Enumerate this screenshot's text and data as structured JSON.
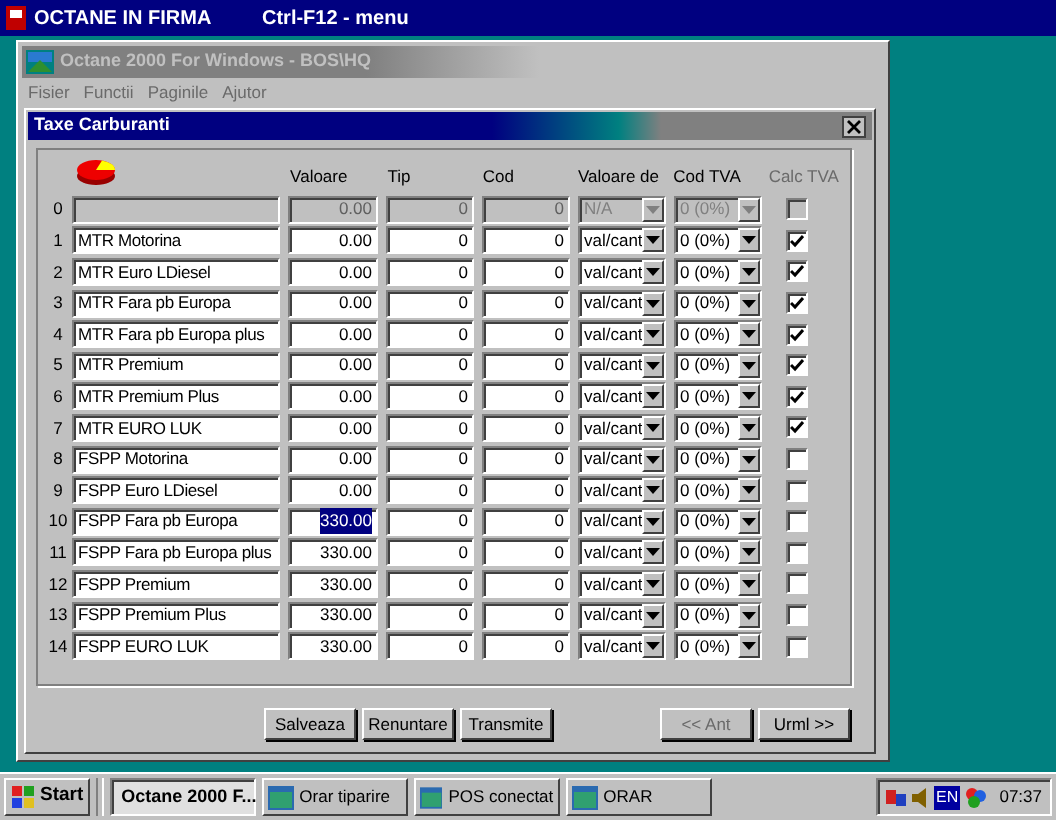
{
  "app_bar": {
    "title": "OCTANE IN FIRMA",
    "shortcut": "Ctrl-F12 - menu"
  },
  "main_window": {
    "title": "Octane 2000 For Windows - BOS\\HQ",
    "active": false,
    "menu": [
      "Fisier",
      "Functii",
      "Paginile",
      "Ajutor"
    ]
  },
  "dialog": {
    "title": "Taxe Carburanti",
    "columns": [
      {
        "label": "Valoare",
        "disabled": false
      },
      {
        "label": "Tip",
        "disabled": false
      },
      {
        "label": "Cod",
        "disabled": false
      },
      {
        "label": "Valoare de",
        "disabled": false
      },
      {
        "label": "Cod TVA",
        "disabled": false
      },
      {
        "label": "Calc TVA",
        "disabled": true
      }
    ],
    "rows": [
      {
        "number": "0",
        "value": "0.00",
        "type": "0",
        "code": "0",
        "value_of": "N/A",
        "vat_code": "0 (0%)",
        "calc_vat": false,
        "disabled": true,
        "value_highlighted": false
      },
      {
        "number": "1",
        "name": "MTR Motorina",
        "value": "0.00",
        "type": "0",
        "code": "0",
        "value_of": "val/cant",
        "vat_code": "0 (0%)",
        "calc_vat": true,
        "disabled": false,
        "value_highlighted": false
      },
      {
        "number": "2",
        "name": "MTR Euro LDiesel",
        "value": "0.00",
        "type": "0",
        "code": "0",
        "value_of": "val/cant",
        "vat_code": "0 (0%)",
        "calc_vat": true,
        "disabled": false,
        "value_highlighted": false
      },
      {
        "number": "3",
        "name": "MTR Fara pb Europa",
        "value": "0.00",
        "type": "0",
        "code": "0",
        "value_of": "val/cant",
        "vat_code": "0 (0%)",
        "calc_vat": true,
        "disabled": false,
        "value_highlighted": false
      },
      {
        "number": "4",
        "name": "MTR Fara pb Europa plus",
        "value": "0.00",
        "type": "0",
        "code": "0",
        "value_of": "val/cant",
        "vat_code": "0 (0%)",
        "calc_vat": true,
        "disabled": false,
        "value_highlighted": false
      },
      {
        "number": "5",
        "name": "MTR Premium",
        "value": "0.00",
        "type": "0",
        "code": "0",
        "value_of": "val/cant",
        "vat_code": "0 (0%)",
        "calc_vat": true,
        "disabled": false,
        "value_highlighted": false
      },
      {
        "number": "6",
        "name": "MTR Premium Plus",
        "value": "0.00",
        "type": "0",
        "code": "0",
        "value_of": "val/cant",
        "vat_code": "0 (0%)",
        "calc_vat": true,
        "disabled": false,
        "value_highlighted": false
      },
      {
        "number": "7",
        "name": "MTR EURO LUK",
        "value": "0.00",
        "type": "0",
        "code": "0",
        "value_of": "val/cant",
        "vat_code": "0 (0%)",
        "calc_vat": true,
        "disabled": false,
        "value_highlighted": false
      },
      {
        "number": "8",
        "name": "FSPP Motorina",
        "value": "0.00",
        "type": "0",
        "code": "0",
        "value_of": "val/cant",
        "vat_code": "0 (0%)",
        "calc_vat": false,
        "disabled": false,
        "value_highlighted": false
      },
      {
        "number": "9",
        "name": "FSPP Euro LDiesel",
        "value": "0.00",
        "type": "0",
        "code": "0",
        "value_of": "val/cant",
        "vat_code": "0 (0%)",
        "calc_vat": false,
        "disabled": false,
        "value_highlighted": false
      },
      {
        "number": "10",
        "name": "FSPP Fara pb Europa",
        "value": "330.00",
        "type": "0",
        "code": "0",
        "value_of": "val/cant",
        "vat_code": "0 (0%)",
        "calc_vat": false,
        "disabled": false,
        "value_highlighted": true
      },
      {
        "number": "11",
        "name": "FSPP Fara pb Europa plus",
        "value": "330.00",
        "type": "0",
        "code": "0",
        "value_of": "val/cant",
        "vat_code": "0 (0%)",
        "calc_vat": false,
        "disabled": false,
        "value_highlighted": false
      },
      {
        "number": "12",
        "name": "FSPP Premium",
        "value": "330.00",
        "type": "0",
        "code": "0",
        "value_of": "val/cant",
        "vat_code": "0 (0%)",
        "calc_vat": false,
        "disabled": false,
        "value_highlighted": false
      },
      {
        "number": "13",
        "name": "FSPP Premium Plus",
        "value": "330.00",
        "type": "0",
        "code": "0",
        "value_of": "val/cant",
        "vat_code": "0 (0%)",
        "calc_vat": false,
        "disabled": false,
        "value_highlighted": false
      },
      {
        "number": "14",
        "name": "FSPP EURO LUK",
        "value": "330.00",
        "type": "0",
        "code": "0",
        "value_of": "val/cant",
        "vat_code": "0 (0%)",
        "calc_vat": false,
        "disabled": false,
        "value_highlighted": false
      }
    ],
    "buttons": [
      {
        "label": "Salveaza",
        "disabled": false
      },
      {
        "label": "Renuntare",
        "disabled": false
      },
      {
        "label": "Transmite",
        "disabled": false
      },
      {
        "label": "<< Ant",
        "disabled": true
      },
      {
        "label": "Urml >>",
        "disabled": false
      }
    ]
  },
  "taskbar": {
    "start": "Start",
    "tasks": [
      {
        "label": "Octane 2000 F...",
        "selected": true
      },
      {
        "label": "Orar tiparire",
        "selected": false
      },
      {
        "label": "POS conectat",
        "selected": false
      },
      {
        "label": "ORAR",
        "selected": false
      }
    ],
    "language": "EN",
    "time": "07:37"
  }
}
